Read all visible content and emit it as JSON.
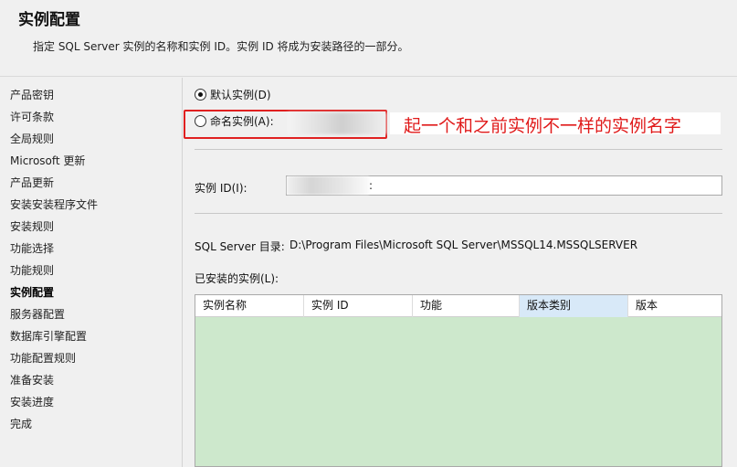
{
  "header": {
    "title": "实例配置",
    "description": "指定 SQL Server 实例的名称和实例 ID。实例 ID 将成为安装路径的一部分。"
  },
  "sidebar": {
    "items": [
      {
        "label": "产品密钥"
      },
      {
        "label": "许可条款"
      },
      {
        "label": "全局规则"
      },
      {
        "label": "Microsoft 更新"
      },
      {
        "label": "产品更新"
      },
      {
        "label": "安装安装程序文件"
      },
      {
        "label": "安装规则"
      },
      {
        "label": "功能选择"
      },
      {
        "label": "功能规则"
      },
      {
        "label": "实例配置",
        "active": true
      },
      {
        "label": "服务器配置"
      },
      {
        "label": "数据库引擎配置"
      },
      {
        "label": "功能配置规则"
      },
      {
        "label": "准备安装"
      },
      {
        "label": "安装进度"
      },
      {
        "label": "完成"
      }
    ]
  },
  "main": {
    "default_instance_label": "默认实例(D)",
    "named_instance_label": "命名实例(A):",
    "annotation": "起一个和之前实例不一样的实例名字",
    "instance_id_label": "实例 ID(I):",
    "instance_id_value": ":",
    "sql_server_dir_label": "SQL Server 目录:",
    "sql_server_dir_value": "D:\\Program Files\\Microsoft SQL Server\\MSSQL14.MSSQLSERVER",
    "installed_instances_label": "已安装的实例(L):",
    "table": {
      "columns": [
        "实例名称",
        "实例 ID",
        "功能",
        "版本类别",
        "版本"
      ]
    }
  },
  "colors": {
    "annotation": "#e01a1a",
    "highlight_border": "#e02020",
    "table_body": "#cde8cc",
    "sorted_header": "#d8e9f8"
  }
}
